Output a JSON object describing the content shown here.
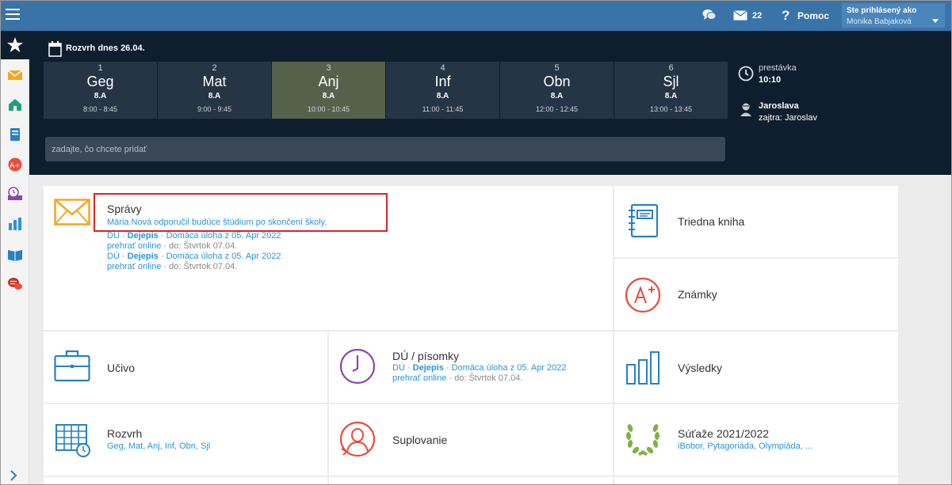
{
  "topbar": {
    "message_count": "22",
    "help_label": "Pomoc",
    "logged_as_label": "Ste prihlásený ako",
    "user_name": "Monika Babjaková"
  },
  "schedule": {
    "title": "Rozvrh dnes 26.04.",
    "periods": [
      {
        "num": "1",
        "subject": "Geg",
        "class": "8.A",
        "time": "8:00 - 8:45"
      },
      {
        "num": "2",
        "subject": "Mat",
        "class": "8.A",
        "time": "9:00 - 9:45"
      },
      {
        "num": "3",
        "subject": "Anj",
        "class": "8.A",
        "time": "10:00 - 10:45"
      },
      {
        "num": "4",
        "subject": "Inf",
        "class": "8.A",
        "time": "11:00 - 11:45"
      },
      {
        "num": "5",
        "subject": "Obn",
        "class": "8.A",
        "time": "12:00 - 12:45"
      },
      {
        "num": "6",
        "subject": "Sjl",
        "class": "8.A",
        "time": "13:00 - 13:45"
      }
    ],
    "search_placeholder": "zadajte, čo chcete pridať",
    "break_label": "prestávka",
    "break_time": "10:10",
    "person_name": "Jaroslava",
    "person_next": "zajtra: Jaroslav"
  },
  "cards": {
    "spravy": {
      "title": "Správy",
      "subtitle": "Mária Nová odporučil budúce štúdium po skončení školy.",
      "hw1_prefix": "DÚ · ",
      "hw1_subject": "Dejepis",
      "hw1_text": " · Domáca úloha z 05. Apr 2022",
      "hw1_online": "prehrať online",
      "hw1_due": " · do: Štvrtok 07.04.",
      "hw2_prefix": "DÚ · ",
      "hw2_subject": "Dejepis",
      "hw2_text": " · Domáca úloha z 05. Apr 2022",
      "hw2_online": "prehrať online",
      "hw2_due": " · do: Štvrtok 07.04."
    },
    "triedna": {
      "title": "Triedna kniha"
    },
    "znamky": {
      "title": "Známky"
    },
    "ucivo": {
      "title": "Učivo"
    },
    "du": {
      "title": "DÚ / písomky",
      "prefix": "DÚ · ",
      "subject": "Dejepis",
      "text": " · Domáca úloha z 05. Apr 2022",
      "online": "prehrať online",
      "due": " · do: Štvrtok 07.04."
    },
    "vysledky": {
      "title": "Výsledky"
    },
    "rozvrh": {
      "title": "Rozvrh",
      "subtitle": "Geg, Mat, Anj, Inf, Obn, Sjl"
    },
    "suplovanie": {
      "title": "Suplovanie"
    },
    "sutaze": {
      "title": "Súťaže 2021/2022",
      "subtitle": "iBobor, Pytagoriáda, Olympiáda, ..."
    }
  },
  "colors": {
    "topbar": "#3a73a8",
    "dark": "#0e1e2e",
    "active_period": "#56614b",
    "link": "#2a95d8",
    "highlight": "#d9242b"
  }
}
